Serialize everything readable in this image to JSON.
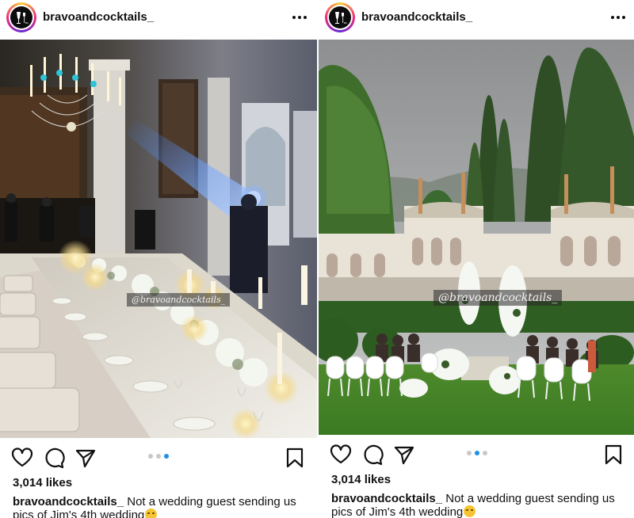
{
  "posts": [
    {
      "username": "bravoandcocktails_",
      "watermark": "@bravoandcocktails_",
      "likes": "3,014 likes",
      "caption_user": "bravoandcocktails_",
      "caption_text": " Not a wedding guest sending us pics of Jim's 4th wedding",
      "carousel_active_index": 2,
      "carousel_count": 3
    },
    {
      "username": "bravoandcocktails_",
      "watermark": "@bravoandcocktails_",
      "likes": "3,014 likes",
      "caption_user": "bravoandcocktails_",
      "caption_text": " Not a wedding guest sending us pics of Jim's 4th wedding",
      "carousel_active_index": 1,
      "carousel_count": 3
    }
  ],
  "icons": {
    "like": "heart-icon",
    "comment": "comment-icon",
    "share": "share-icon",
    "save": "bookmark-icon",
    "more": "more-options-icon",
    "emoji": "grimacing-face-emoji"
  },
  "colors": {
    "carousel_active": "#1e90e8",
    "carousel_inactive": "#c8c8c8"
  }
}
